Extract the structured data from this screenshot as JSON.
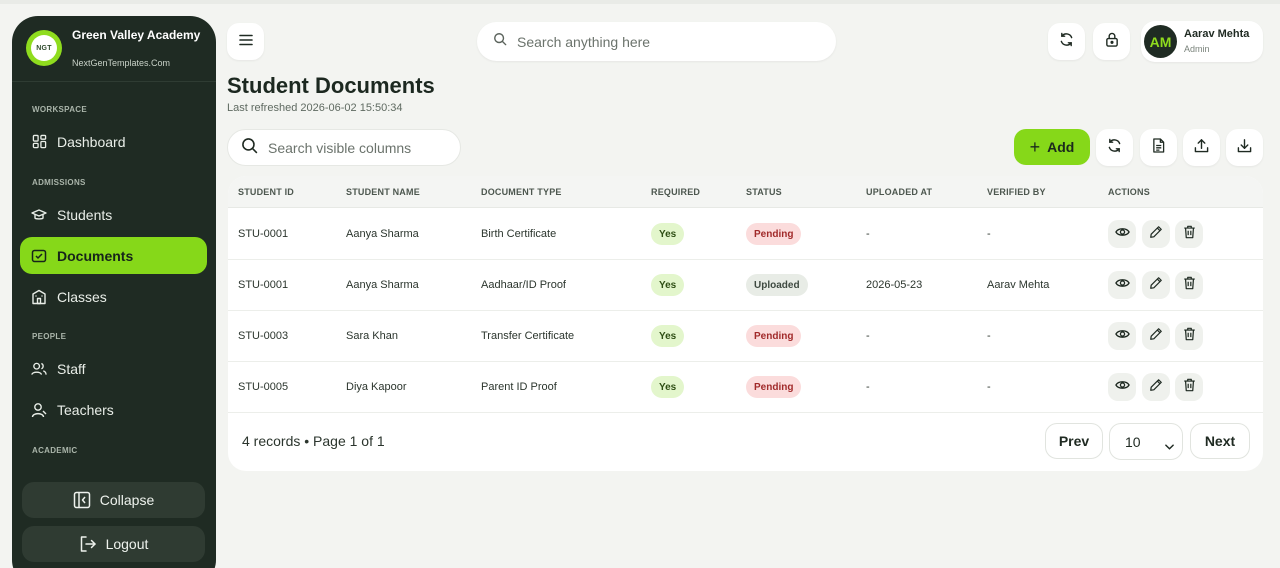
{
  "brand": {
    "name": "Green Valley Academy",
    "logo_text": "NGT",
    "subtitle": "NextGenTemplates.Com"
  },
  "sidebar": {
    "sections": [
      "WORKSPACE",
      "ADMISSIONS",
      "PEOPLE",
      "ACADEMIC"
    ],
    "items": [
      {
        "label": "Dashboard",
        "icon": "dashboard-icon"
      },
      {
        "label": "Students",
        "icon": "graduation-cap-icon"
      },
      {
        "label": "Documents",
        "icon": "document-check-icon",
        "active": true
      },
      {
        "label": "Classes",
        "icon": "building-icon"
      },
      {
        "label": "Staff",
        "icon": "users-icon"
      },
      {
        "label": "Teachers",
        "icon": "user-icon"
      }
    ],
    "collapse_label": "Collapse",
    "logout_label": "Logout"
  },
  "topbar": {
    "search_placeholder": "Search anything here",
    "user": {
      "initials": "AM",
      "name": "Aarav Mehta",
      "role": "Admin"
    }
  },
  "page": {
    "title": "Student Documents",
    "subtitle": "Last refreshed 2026-06-02 15:50:34"
  },
  "toolbar": {
    "search_placeholder": "Search visible columns",
    "add_label": "Add"
  },
  "table": {
    "columns": [
      "STUDENT ID",
      "STUDENT NAME",
      "DOCUMENT TYPE",
      "REQUIRED",
      "STATUS",
      "UPLOADED AT",
      "VERIFIED BY",
      "ACTIONS"
    ],
    "rows": [
      {
        "student_id": "STU-0001",
        "student_name": "Aanya Sharma",
        "document_type": "Birth Certificate",
        "required": "Yes",
        "status": "Pending",
        "uploaded_at": "-",
        "verified_by": "-"
      },
      {
        "student_id": "STU-0001",
        "student_name": "Aanya Sharma",
        "document_type": "Aadhaar/ID Proof",
        "required": "Yes",
        "status": "Uploaded",
        "uploaded_at": "2026-05-23",
        "verified_by": "Aarav Mehta"
      },
      {
        "student_id": "STU-0003",
        "student_name": "Sara Khan",
        "document_type": "Transfer Certificate",
        "required": "Yes",
        "status": "Pending",
        "uploaded_at": "-",
        "verified_by": "-"
      },
      {
        "student_id": "STU-0005",
        "student_name": "Diya Kapoor",
        "document_type": "Parent ID Proof",
        "required": "Yes",
        "status": "Pending",
        "uploaded_at": "-",
        "verified_by": "-"
      }
    ]
  },
  "pagination": {
    "summary": "4 records • Page 1 of 1",
    "prev_label": "Prev",
    "next_label": "Next",
    "page_size": "10"
  },
  "colors": {
    "accent": "#86d819",
    "sidebar": "#1f2b23",
    "pending": "#a12a2a",
    "background": "#f3f4f1"
  }
}
